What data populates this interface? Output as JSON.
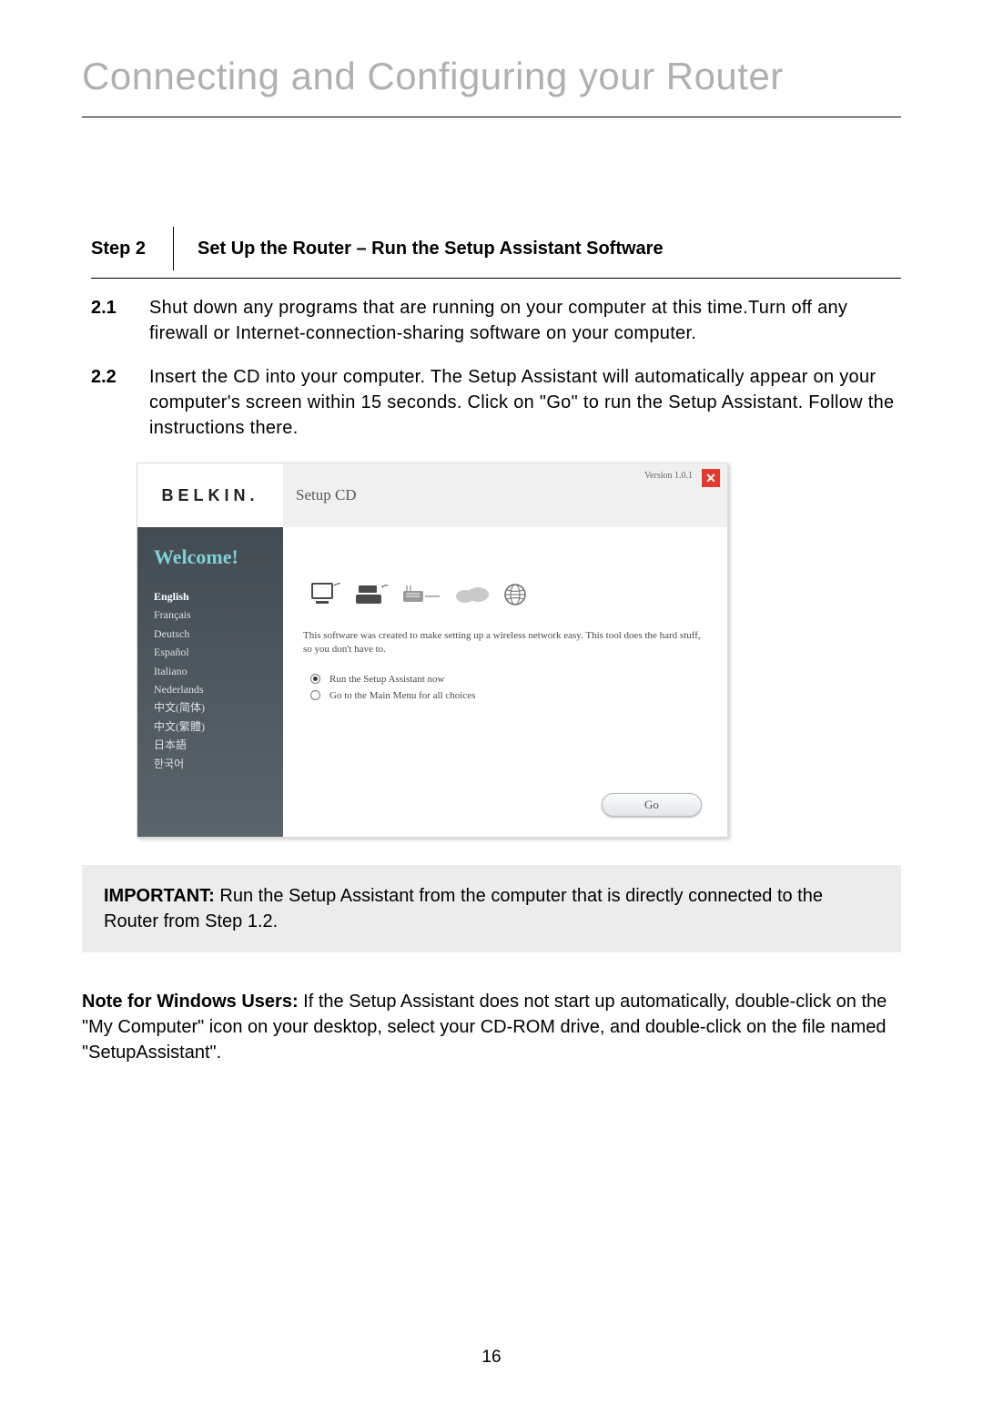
{
  "page": {
    "title": "Connecting and Configuring your Router",
    "number": "16"
  },
  "step_header": {
    "label": "Step 2",
    "title": "Set Up the Router – Run the Setup Assistant Software"
  },
  "steps": [
    {
      "num": "2.1",
      "text": "Shut down any programs that are running on your computer at this time.Turn off any firewall or Internet-connection-sharing software on your computer."
    },
    {
      "num": "2.2",
      "text": "Insert the CD into your computer. The Setup Assistant will automatically appear on your computer's screen within 15 seconds. Click on \"Go\" to run the Setup Assistant. Follow the instructions there."
    }
  ],
  "app": {
    "brand": "BELKIN.",
    "header_title": "Setup CD",
    "version": "Version 1.0.1",
    "close_glyph": "✕",
    "welcome": "Welcome!",
    "languages": [
      "English",
      "Français",
      "Deutsch",
      "Español",
      "Italiano",
      "Nederlands",
      "中文(简体)",
      "中文(繁體)",
      "日本語",
      "한국어"
    ],
    "intro": "This software was created to make setting up a wireless network easy. This tool does the hard stuff, so you don't have to.",
    "options": {
      "run_now": "Run the Setup Assistant now",
      "main_menu": "Go to the Main Menu for all choices"
    },
    "go_label": "Go"
  },
  "important": {
    "label": "IMPORTANT:",
    "text": " Run the Setup Assistant from the computer that is directly connected to the Router from Step 1.2."
  },
  "note": {
    "label": "Note for Windows Users:",
    "text": " If the Setup Assistant does not start up automatically, double-click on the \"My Computer\" icon on your desktop, select your CD-ROM drive, and double-click on the file named \"SetupAssistant\"."
  }
}
